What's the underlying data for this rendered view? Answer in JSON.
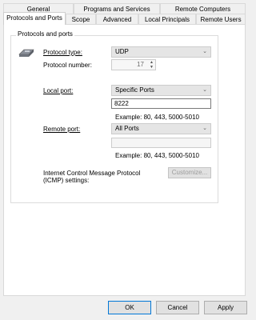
{
  "tabs": {
    "row_back": [
      "General",
      "Programs and Services",
      "Remote Computers"
    ],
    "row_front": [
      "Protocols and Ports",
      "Scope",
      "Advanced",
      "Local Principals",
      "Remote Users"
    ]
  },
  "group_title": "Protocols and ports",
  "protocol_type": {
    "label": "Protocol type:",
    "value": "UDP"
  },
  "protocol_number": {
    "label": "Protocol number:",
    "value": "17"
  },
  "local_port": {
    "label": "Local port:",
    "value": "Specific Ports",
    "input": "8222",
    "example": "Example: 80, 443, 5000-5010"
  },
  "remote_port": {
    "label": "Remote port:",
    "value": "All Ports",
    "input": "",
    "example": "Example: 80, 443, 5000-5010"
  },
  "icmp": {
    "label_line1": "Internet Control Message Protocol",
    "label_line2": "(ICMP) settings:",
    "button": "Customize..."
  },
  "buttons": {
    "ok": "OK",
    "cancel": "Cancel",
    "apply": "Apply"
  }
}
